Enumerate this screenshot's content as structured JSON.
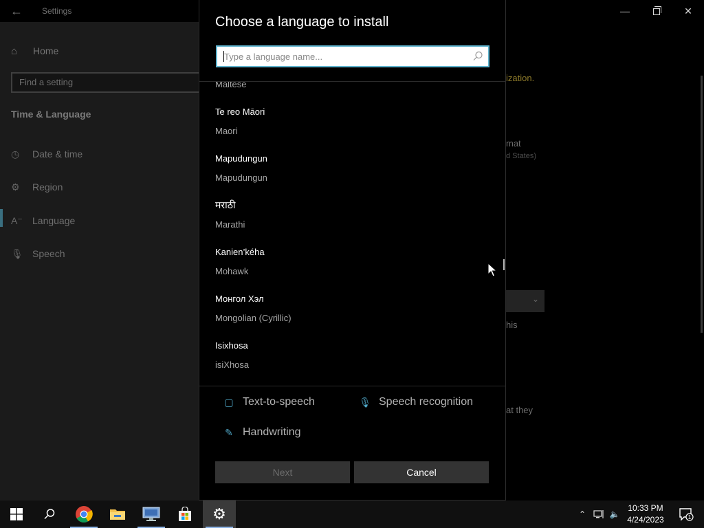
{
  "settings_window": {
    "title": "Settings",
    "home": "Home",
    "find_placeholder": "Find a setting",
    "section": "Time & Language",
    "nav": [
      {
        "label": "Date & time",
        "icon": "calendar-clock-icon"
      },
      {
        "label": "Region",
        "icon": "globe-icon"
      },
      {
        "label": "Language",
        "icon": "language-icon"
      },
      {
        "label": "Speech",
        "icon": "microphone-icon"
      }
    ],
    "active_nav": "Language",
    "background_fragments": [
      "ization.",
      "mat",
      "d States)",
      "his",
      "at they"
    ]
  },
  "dialog": {
    "title": "Choose a language to install",
    "search_placeholder": "Type a language name...",
    "partial_top": "Maltese",
    "languages": [
      {
        "native": "Te reo Māori",
        "english": "Maori"
      },
      {
        "native": "Mapudungun",
        "english": "Mapudungun"
      },
      {
        "native": "मराठी",
        "english": "Marathi"
      },
      {
        "native": "Kanien’kéha",
        "english": "Mohawk"
      },
      {
        "native": "Монгол Хэл",
        "english": "Mongolian (Cyrillic)"
      },
      {
        "native": "Isixhosa",
        "english": "isiXhosa"
      }
    ],
    "features": {
      "tts": "Text-to-speech",
      "speech": "Speech recognition",
      "handwriting": "Handwriting"
    },
    "next_label": "Next",
    "cancel_label": "Cancel"
  },
  "taskbar": {
    "apps": [
      "start",
      "search",
      "chrome",
      "file-explorer",
      "remote-desktop",
      "store",
      "settings"
    ],
    "time": "10:33 PM",
    "date": "4/24/2023",
    "notification_count": "1"
  },
  "colors": {
    "accent": "#5fb4cf",
    "button_bg": "#333333",
    "dialog_bg": "#000000"
  }
}
